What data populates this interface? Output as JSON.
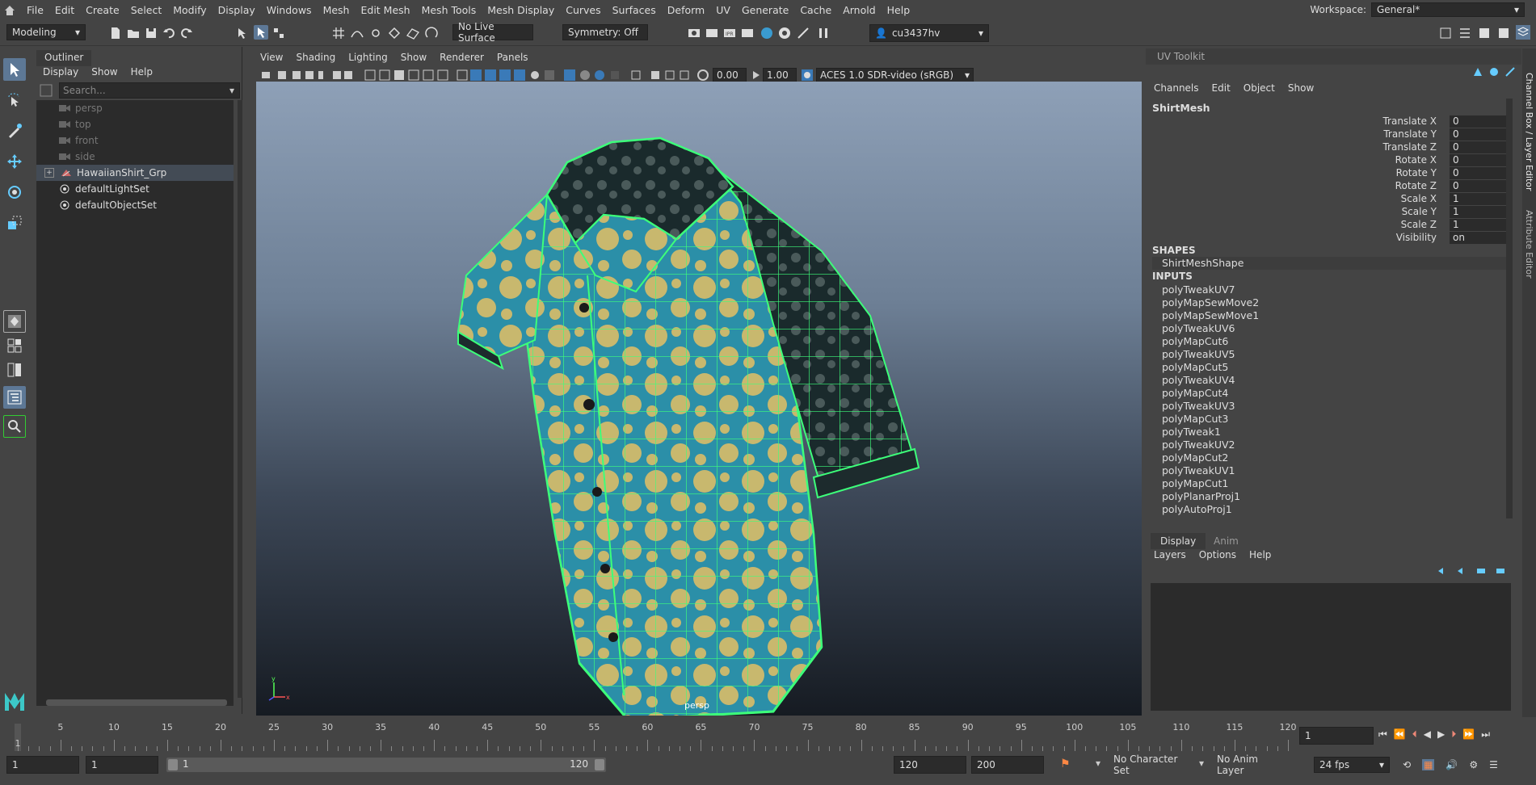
{
  "menubar": {
    "items": [
      "File",
      "Edit",
      "Create",
      "Select",
      "Modify",
      "Display",
      "Windows",
      "Mesh",
      "Edit Mesh",
      "Mesh Tools",
      "Mesh Display",
      "Curves",
      "Surfaces",
      "Deform",
      "UV",
      "Generate",
      "Cache",
      "Arnold",
      "Help"
    ],
    "workspace_label": "Workspace:",
    "workspace_value": "General*"
  },
  "statusline": {
    "menuset": "Modeling",
    "live_surface": "No Live Surface",
    "symmetry": "Symmetry: Off",
    "user": "cu3437hv"
  },
  "outliner": {
    "title": "Outliner",
    "menus": [
      "Display",
      "Show",
      "Help"
    ],
    "search_placeholder": "Search...",
    "items": [
      {
        "label": "persp",
        "kind": "camera"
      },
      {
        "label": "top",
        "kind": "camera"
      },
      {
        "label": "front",
        "kind": "camera"
      },
      {
        "label": "side",
        "kind": "camera"
      },
      {
        "label": "HawaiianShirt_Grp",
        "kind": "group"
      },
      {
        "label": "defaultLightSet",
        "kind": "set"
      },
      {
        "label": "defaultObjectSet",
        "kind": "set"
      }
    ]
  },
  "viewport": {
    "menus": [
      "View",
      "Shading",
      "Lighting",
      "Show",
      "Renderer",
      "Panels"
    ],
    "exposure": "0.00",
    "gamma": "1.00",
    "colorspace": "ACES 1.0 SDR-video (sRGB)",
    "camera_label": "persp"
  },
  "channelbox": {
    "tab": "UV Toolkit",
    "menus": [
      "Channels",
      "Edit",
      "Object",
      "Show"
    ],
    "object": "ShirtMesh",
    "attributes": [
      {
        "name": "Translate X",
        "value": "0"
      },
      {
        "name": "Translate Y",
        "value": "0"
      },
      {
        "name": "Translate Z",
        "value": "0"
      },
      {
        "name": "Rotate X",
        "value": "0"
      },
      {
        "name": "Rotate Y",
        "value": "0"
      },
      {
        "name": "Rotate Z",
        "value": "0"
      },
      {
        "name": "Scale X",
        "value": "1"
      },
      {
        "name": "Scale Y",
        "value": "1"
      },
      {
        "name": "Scale Z",
        "value": "1"
      },
      {
        "name": "Visibility",
        "value": "on"
      }
    ],
    "shapes_header": "SHAPES",
    "shape": "ShirtMeshShape",
    "inputs_header": "INPUTS",
    "inputs": [
      "polyTweakUV7",
      "polyMapSewMove2",
      "polyMapSewMove1",
      "polyTweakUV6",
      "polyMapCut6",
      "polyTweakUV5",
      "polyMapCut5",
      "polyTweakUV4",
      "polyMapCut4",
      "polyTweakUV3",
      "polyMapCut3",
      "polyTweak1",
      "polyTweakUV2",
      "polyMapCut2",
      "polyTweakUV1",
      "polyMapCut1",
      "polyPlanarProj1",
      "polyAutoProj1"
    ]
  },
  "layers": {
    "tabs": [
      "Display",
      "Anim"
    ],
    "menus": [
      "Layers",
      "Options",
      "Help"
    ]
  },
  "side_tabs": [
    "Channel Box / Layer Editor",
    "Attribute Editor"
  ],
  "timeline": {
    "ticks": [
      "5",
      "10",
      "15",
      "20",
      "25",
      "30",
      "35",
      "40",
      "45",
      "50",
      "55",
      "60",
      "65",
      "70",
      "75",
      "80",
      "85",
      "90",
      "95",
      "100",
      "105",
      "110",
      "115",
      "120"
    ],
    "current_frame_marker": "1",
    "current_frame": "1"
  },
  "range": {
    "start": "1",
    "playback_start": "1",
    "slider_start": "1",
    "slider_end": "120",
    "playback_end": "120",
    "end": "200",
    "character_set": "No Character Set",
    "anim_layer": "No Anim Layer",
    "fps": "24 fps"
  }
}
